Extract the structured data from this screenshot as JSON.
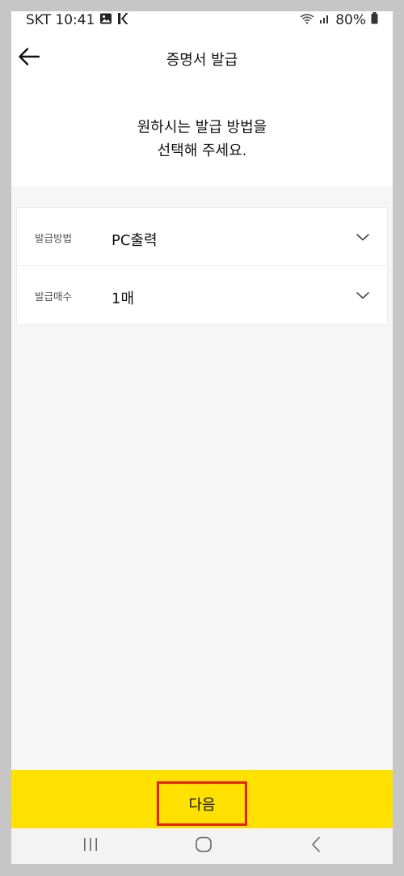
{
  "status_bar": {
    "carrier_time": "SKT 10:41",
    "battery": "80%"
  },
  "header": {
    "title": "증명서 발급"
  },
  "intro": {
    "line1": "원하시는 발급 방법을",
    "line2": "선택해 주세요."
  },
  "options": [
    {
      "label": "발급방법",
      "value": "PC출력"
    },
    {
      "label": "발급매수",
      "value": "1매"
    }
  ],
  "footer": {
    "next_label": "다음"
  },
  "colors": {
    "accent_yellow": "#ffe100",
    "highlight_red": "#e41f1f"
  },
  "icons": [
    "image-icon",
    "kakao-k-icon",
    "wifi-icon",
    "signal-icon",
    "battery-icon",
    "back-arrow-icon",
    "chevron-down-icon",
    "nav-recent-icon",
    "nav-home-icon",
    "nav-back-icon"
  ]
}
